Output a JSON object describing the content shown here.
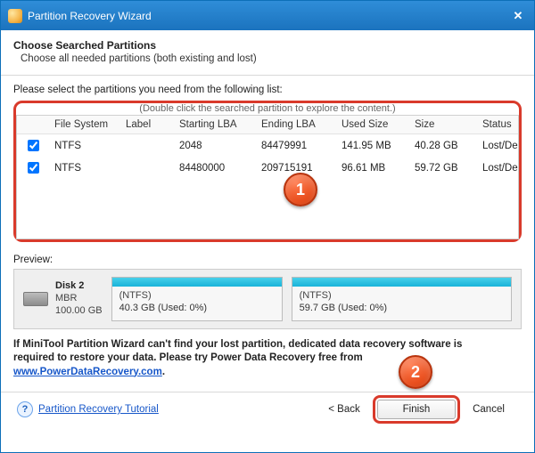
{
  "titlebar": {
    "title": "Partition Recovery Wizard"
  },
  "header": {
    "title": "Choose Searched Partitions",
    "subtitle": "Choose all needed partitions (both existing and lost)"
  },
  "list": {
    "prompt": "Please select the partitions you need from the following list:",
    "truncated_hint": "(Double click the searched partition to explore the content.)",
    "columns": {
      "chk": "",
      "filesystem": "File System",
      "label": "Label",
      "starting_lba": "Starting LBA",
      "ending_lba": "Ending LBA",
      "used_size": "Used Size",
      "size": "Size",
      "status": "Status"
    },
    "rows": [
      {
        "checked": true,
        "filesystem": "NTFS",
        "label": "",
        "starting_lba": "2048",
        "ending_lba": "84479991",
        "used_size": "141.95 MB",
        "size": "40.28 GB",
        "status": "Lost/Deleted"
      },
      {
        "checked": true,
        "filesystem": "NTFS",
        "label": "",
        "starting_lba": "84480000",
        "ending_lba": "209715191",
        "used_size": "96.61 MB",
        "size": "59.72 GB",
        "status": "Lost/Deleted"
      }
    ]
  },
  "preview": {
    "label": "Preview:",
    "disk": {
      "name": "Disk 2",
      "type": "MBR",
      "capacity": "100.00 GB"
    },
    "partitions": [
      {
        "fs": "(NTFS)",
        "summary": "40.3 GB (Used: 0%)"
      },
      {
        "fs": "(NTFS)",
        "summary": "59.7 GB (Used: 0%)"
      }
    ]
  },
  "note": {
    "line1": "If MiniTool Partition Wizard can't find your lost partition, dedicated data recovery software is",
    "line2": "required to restore your data. Please try Power Data Recovery free from",
    "link_text": "www.PowerDataRecovery.com",
    "dot": "."
  },
  "footer": {
    "tutorial": "Partition Recovery Tutorial",
    "back": "< Back",
    "finish": "Finish",
    "cancel": "Cancel"
  },
  "annotations": {
    "b1": "1",
    "b2": "2"
  }
}
